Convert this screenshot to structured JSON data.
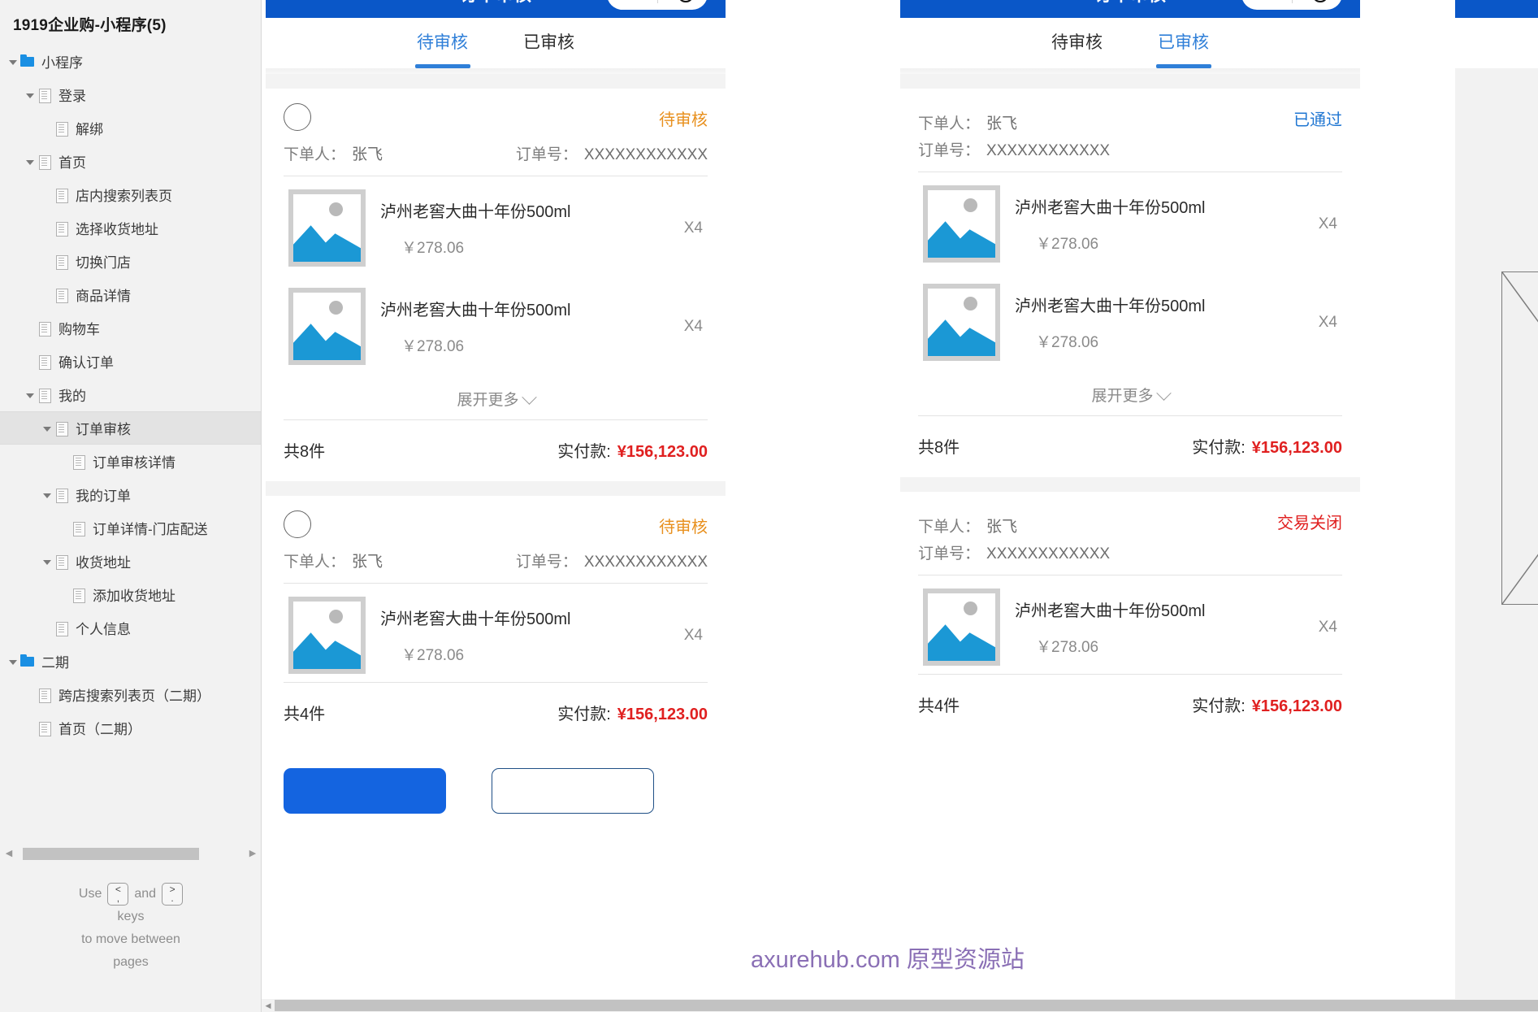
{
  "sidebar": {
    "title": "1919企业购-小程序(5)",
    "items": [
      {
        "label": "小程序",
        "depth": 0,
        "icon": "folder-icon",
        "arrow": "open",
        "selected": false
      },
      {
        "label": "登录",
        "depth": 1,
        "icon": "page-icon",
        "arrow": "open",
        "selected": false
      },
      {
        "label": "解绑",
        "depth": 2,
        "icon": "page-icon",
        "arrow": "none",
        "selected": false
      },
      {
        "label": "首页",
        "depth": 1,
        "icon": "page-icon",
        "arrow": "open",
        "selected": false
      },
      {
        "label": "店内搜索列表页",
        "depth": 2,
        "icon": "page-icon",
        "arrow": "none",
        "selected": false
      },
      {
        "label": "选择收货地址",
        "depth": 2,
        "icon": "page-icon",
        "arrow": "none",
        "selected": false
      },
      {
        "label": "切换门店",
        "depth": 2,
        "icon": "page-icon",
        "arrow": "none",
        "selected": false
      },
      {
        "label": "商品详情",
        "depth": 2,
        "icon": "page-icon",
        "arrow": "none",
        "selected": false
      },
      {
        "label": "购物车",
        "depth": 1,
        "icon": "page-icon",
        "arrow": "none",
        "selected": false
      },
      {
        "label": "确认订单",
        "depth": 1,
        "icon": "page-icon",
        "arrow": "none",
        "selected": false
      },
      {
        "label": "我的",
        "depth": 1,
        "icon": "page-icon",
        "arrow": "open",
        "selected": false
      },
      {
        "label": "订单审核",
        "depth": 2,
        "icon": "page-icon",
        "arrow": "open",
        "selected": true
      },
      {
        "label": "订单审核详情",
        "depth": 3,
        "icon": "page-icon",
        "arrow": "none",
        "selected": false
      },
      {
        "label": "我的订单",
        "depth": 2,
        "icon": "page-icon",
        "arrow": "open",
        "selected": false
      },
      {
        "label": "订单详情-门店配送",
        "depth": 3,
        "icon": "page-icon",
        "arrow": "none",
        "selected": false
      },
      {
        "label": "收货地址",
        "depth": 2,
        "icon": "page-icon",
        "arrow": "open",
        "selected": false
      },
      {
        "label": "添加收货地址",
        "depth": 3,
        "icon": "page-icon",
        "arrow": "none",
        "selected": false
      },
      {
        "label": "个人信息",
        "depth": 2,
        "icon": "page-icon",
        "arrow": "none",
        "selected": false
      },
      {
        "label": "二期",
        "depth": 0,
        "icon": "folder-icon",
        "arrow": "open",
        "selected": false
      },
      {
        "label": "跨店搜索列表页（二期）",
        "depth": 1,
        "icon": "page-icon",
        "arrow": "none",
        "selected": false
      },
      {
        "label": "首页（二期）",
        "depth": 1,
        "icon": "page-icon",
        "arrow": "none",
        "selected": false
      }
    ],
    "hint": {
      "use": "Use",
      "and": "and",
      "key_prev_top": "<",
      "key_prev_bottom": ",",
      "key_next_top": ">",
      "key_next_bottom": ".",
      "line2": "keys",
      "line3": "to move between",
      "line4": "pages"
    },
    "scroll_left_arrow": "◀",
    "scroll_right_arrow": "▶"
  },
  "watermark": "axurehub.com 原型资源站",
  "phone1": {
    "header_title": "订单审核",
    "tabs": [
      {
        "label": "待审核",
        "active": true
      },
      {
        "label": "已审核",
        "active": false
      }
    ],
    "cards": [
      {
        "has_radio": true,
        "status": "待审核",
        "status_kind": "pending",
        "buyer_label": "下单人：",
        "buyer_value": "张飞",
        "order_label": "订单号：",
        "order_value": "XXXXXXXXXXXX",
        "products": [
          {
            "name": "泸州老窖大曲十年份500ml",
            "price": "￥278.06",
            "qty": "X4"
          },
          {
            "name": "泸州老窖大曲十年份500ml",
            "price": "￥278.06",
            "qty": "X4"
          }
        ],
        "expand_label": "展开更多",
        "count_label": "共8件",
        "pay_label": "实付款:",
        "pay_amount": "¥156,123.00"
      },
      {
        "has_radio": true,
        "status": "待审核",
        "status_kind": "pending",
        "buyer_label": "下单人：",
        "buyer_value": "张飞",
        "order_label": "订单号：",
        "order_value": "XXXXXXXXXXXX",
        "products": [
          {
            "name": "泸州老窖大曲十年份500ml",
            "price": "￥278.06",
            "qty": "X4"
          }
        ],
        "count_label": "共4件",
        "pay_label": "实付款:",
        "pay_amount": "¥156,123.00"
      }
    ],
    "buttons": {
      "primary": "",
      "outline": ""
    }
  },
  "phone2": {
    "header_title": "订单审核",
    "tabs": [
      {
        "label": "待审核",
        "active": false
      },
      {
        "label": "已审核",
        "active": true
      }
    ],
    "cards": [
      {
        "has_radio": false,
        "status": "已通过",
        "status_kind": "passed",
        "buyer_label": "下单人：",
        "buyer_value": "张飞",
        "order_label": "订单号：",
        "order_value": "XXXXXXXXXXXX",
        "products": [
          {
            "name": "泸州老窖大曲十年份500ml",
            "price": "￥278.06",
            "qty": "X4"
          },
          {
            "name": "泸州老窖大曲十年份500ml",
            "price": "￥278.06",
            "qty": "X4"
          }
        ],
        "expand_label": "展开更多",
        "count_label": "共8件",
        "pay_label": "实付款:",
        "pay_amount": "¥156,123.00"
      },
      {
        "has_radio": false,
        "status": "交易关闭",
        "status_kind": "closed",
        "buyer_label": "下单人：",
        "buyer_value": "张飞",
        "order_label": "订单号：",
        "order_value": "XXXXXXXXXXXX",
        "products": [
          {
            "name": "泸州老窖大曲十年份500ml",
            "price": "￥278.06",
            "qty": "X4"
          }
        ],
        "count_label": "共4件",
        "pay_label": "实付款:",
        "pay_amount": "¥156,123.00"
      }
    ]
  },
  "phone3": {
    "header_title": ""
  },
  "colors": {
    "brand_blue": "#0a57c8",
    "tab_active": "#2f7fd8",
    "status_pending": "#e8901e",
    "status_passed": "#1f76d2",
    "status_closed": "#e02020",
    "price_red": "#e02020",
    "thumb_blue": "#1b98d5",
    "watermark_purple": "#8a6fb5"
  }
}
